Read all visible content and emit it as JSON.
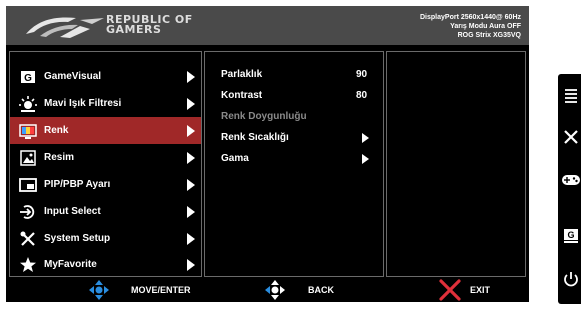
{
  "header": {
    "brand_line1": "REPUBLIC OF",
    "brand_line2": "GAMERS",
    "info_line1": "DisplayPort 2560x1440@ 60Hz",
    "info_line2": "Yarış Modu Aura OFF",
    "info_line3": "ROG Strix XG35VQ"
  },
  "menu": [
    {
      "label": "GameVisual",
      "icon": "gamevisual-icon",
      "selected": false
    },
    {
      "label": "Mavi Işık Filtresi",
      "icon": "blue-light-icon",
      "selected": false
    },
    {
      "label": "Renk",
      "icon": "color-icon",
      "selected": true
    },
    {
      "label": "Resim",
      "icon": "image-icon",
      "selected": false
    },
    {
      "label": "PIP/PBP Ayarı",
      "icon": "pip-icon",
      "selected": false
    },
    {
      "label": "Input Select",
      "icon": "input-icon",
      "selected": false
    },
    {
      "label": "System Setup",
      "icon": "wrench-icon",
      "selected": false
    },
    {
      "label": "MyFavorite",
      "icon": "star-icon",
      "selected": false
    }
  ],
  "submenu": [
    {
      "label": "Parlaklık",
      "value": "90",
      "enabled": true
    },
    {
      "label": "Kontrast",
      "value": "80",
      "enabled": true
    },
    {
      "label": "Renk Doygunluğu",
      "value": "",
      "enabled": false
    },
    {
      "label": "Renk Sıcaklığı",
      "value": "",
      "enabled": true
    },
    {
      "label": "Gama",
      "value": "",
      "enabled": true
    }
  ],
  "footer": {
    "move_label": "MOVE/ENTER",
    "back_label": "BACK",
    "exit_label": "EXIT"
  },
  "side_buttons": [
    "menu-icon",
    "close-icon",
    "gamepad-icon",
    "gamevisual-shortcut-icon",
    "power-icon"
  ],
  "colors": {
    "selected": "#a02828",
    "nav_blue": "#2a8ee0",
    "exit_red": "#e0303a",
    "header": "#4a4a4a"
  }
}
